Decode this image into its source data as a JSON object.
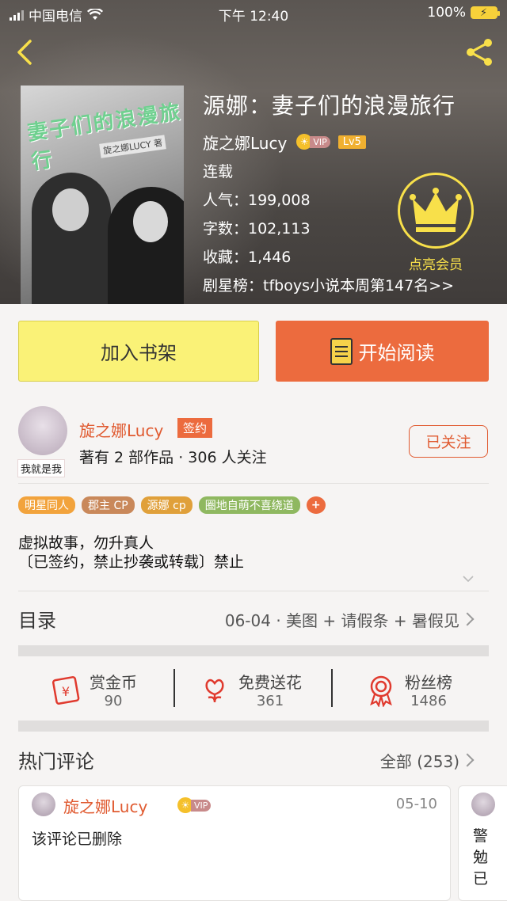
{
  "status_bar": {
    "carrier": "中国电信",
    "time": "下午 12:40",
    "battery": "100%"
  },
  "book": {
    "title": "源娜：妻子们的浪漫旅行",
    "author": "旋之娜Lucy",
    "vip_label": "VIP",
    "level": "Lv5",
    "status": "连载",
    "popularity": "人气：199,008",
    "word_count": "字数：102,113",
    "favorites": "收藏：1,446",
    "ranking": "剧星榜：tfboys小说本周第147名>>",
    "cover_title": "妻子们的浪漫旅行",
    "cover_author": "旋之娜LUCY 著"
  },
  "membership": {
    "label": "点亮会员",
    "color": "#f8e04a"
  },
  "actions": {
    "add_shelf": "加入书架",
    "start_read": "开始阅读"
  },
  "author_card": {
    "avatar_tag": "我就是我",
    "name": "旋之娜Lucy",
    "signed_badge": "签约",
    "meta": "著有 2 部作品 · 306 人关注",
    "follow_button": "已关注"
  },
  "tags": [
    {
      "label": "明星同人",
      "color": "#f2a33c"
    },
    {
      "label": "郡主 CP",
      "color": "#c9885a"
    },
    {
      "label": "源娜 cp",
      "color": "#e0a03a"
    },
    {
      "label": "圈地自萌不喜绕道",
      "color": "#8fb860"
    },
    {
      "label": "+",
      "color": "#ec6b3e"
    }
  ],
  "description": {
    "line1": "虚拟故事，勿升真人",
    "line2": "〔已签约，禁止抄袭或转载〕禁止"
  },
  "toc": {
    "label": "目录",
    "latest": "06-04 · 美图 + 请假条 + 暑假见"
  },
  "stats": [
    {
      "label": "赏金币",
      "value": "90",
      "icon": "red-envelope-icon"
    },
    {
      "label": "免费送花",
      "value": "361",
      "icon": "flower-icon"
    },
    {
      "label": "粉丝榜",
      "value": "1486",
      "icon": "medal-icon"
    }
  ],
  "comments_section": {
    "title": "热门评论",
    "all_label": "全部 (253)"
  },
  "comments": [
    {
      "author": "旋之娜Lucy",
      "vip": "VIP",
      "date": "05-10",
      "text": "该评论已删除"
    },
    {
      "text_lines": [
        "警",
        "勉",
        "已"
      ]
    }
  ],
  "colors": {
    "accent_orange": "#ec6b3e",
    "shelf_yellow": "#faf277",
    "author_red": "#e05a30"
  }
}
